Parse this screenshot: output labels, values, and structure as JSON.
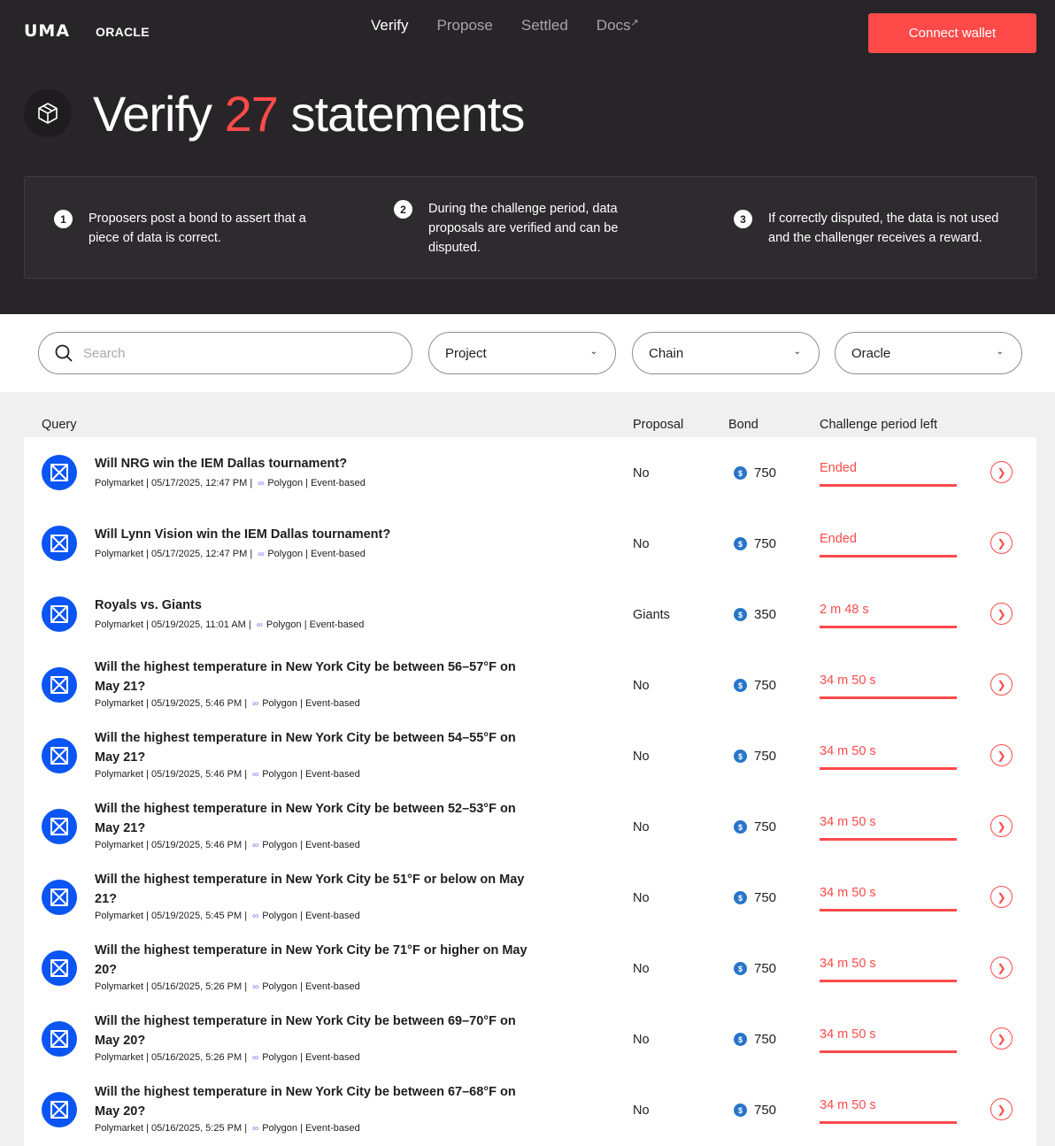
{
  "header": {
    "logo": "UMA",
    "logo_sub": "ORACLE",
    "nav": [
      {
        "label": "Verify"
      },
      {
        "label": "Propose"
      },
      {
        "label": "Settled"
      },
      {
        "label": "Docs"
      }
    ],
    "connect_label": "Connect wallet"
  },
  "hero": {
    "title_pre": "Verify",
    "title_count": "27",
    "title_post": "statements",
    "steps": [
      {
        "num": "1",
        "text": "Proposers post a bond to assert that a piece of data is correct."
      },
      {
        "num": "2",
        "text": "During the challenge period, data proposals are verified and can be disputed."
      },
      {
        "num": "3",
        "text": "If correctly disputed, the data is not used and the challenger receives a reward."
      }
    ]
  },
  "filters": {
    "search_placeholder": "Search",
    "project": "Project",
    "chain": "Chain",
    "oracle": "Oracle"
  },
  "table": {
    "columns": [
      "Query",
      "Proposal",
      "Bond",
      "Challenge period left"
    ],
    "rows": [
      {
        "title": "Will NRG win the IEM Dallas tournament?",
        "project": "Polymarket",
        "date": "05/17/2025, 12:47 PM",
        "chain": "Polygon",
        "type": "Event-based",
        "proposal": "No",
        "bond": "750",
        "period": "Ended"
      },
      {
        "title": "Will Lynn Vision win the IEM Dallas tournament?",
        "project": "Polymarket",
        "date": "05/17/2025, 12:47 PM",
        "chain": "Polygon",
        "type": "Event-based",
        "proposal": "No",
        "bond": "750",
        "period": "Ended"
      },
      {
        "title": "Royals vs. Giants",
        "project": "Polymarket",
        "date": "05/19/2025, 11:01 AM",
        "chain": "Polygon",
        "type": "Event-based",
        "proposal": "Giants",
        "bond": "350",
        "period": "2 m 48 s"
      },
      {
        "title": "Will the highest temperature in New York City be between 56–57°F on May 21?",
        "project": "Polymarket",
        "date": "05/19/2025, 5:46 PM",
        "chain": "Polygon",
        "type": "Event-based",
        "proposal": "No",
        "bond": "750",
        "period": "34 m 50 s"
      },
      {
        "title": "Will the highest temperature in New York City be between 54–55°F on May 21?",
        "project": "Polymarket",
        "date": "05/19/2025, 5:46 PM",
        "chain": "Polygon",
        "type": "Event-based",
        "proposal": "No",
        "bond": "750",
        "period": "34 m 50 s"
      },
      {
        "title": "Will the highest temperature in New York City be between 52–53°F on May 21?",
        "project": "Polymarket",
        "date": "05/19/2025, 5:46 PM",
        "chain": "Polygon",
        "type": "Event-based",
        "proposal": "No",
        "bond": "750",
        "period": "34 m 50 s"
      },
      {
        "title": "Will the highest temperature in New York City be 51°F or below on May 21?",
        "project": "Polymarket",
        "date": "05/19/2025, 5:45 PM",
        "chain": "Polygon",
        "type": "Event-based",
        "proposal": "No",
        "bond": "750",
        "period": "34 m 50 s"
      },
      {
        "title": "Will the highest temperature in New York City be 71°F or higher on May 20?",
        "project": "Polymarket",
        "date": "05/16/2025, 5:26 PM",
        "chain": "Polygon",
        "type": "Event-based",
        "proposal": "No",
        "bond": "750",
        "period": "34 m 50 s"
      },
      {
        "title": "Will the highest temperature in New York City be between 69–70°F on May 20?",
        "project": "Polymarket",
        "date": "05/16/2025, 5:26 PM",
        "chain": "Polygon",
        "type": "Event-based",
        "proposal": "No",
        "bond": "750",
        "period": "34 m 50 s"
      },
      {
        "title": "Will the highest temperature in New York City be between 67–68°F on May 20?",
        "project": "Polymarket",
        "date": "05/16/2025, 5:25 PM",
        "chain": "Polygon",
        "type": "Event-based",
        "proposal": "No",
        "bond": "750",
        "period": "34 m 50 s"
      }
    ]
  },
  "colors": {
    "accent": "#ff4a4a",
    "hero_bg": "#272528",
    "project_icon": "#0a55f3",
    "usdc": "#2775ca"
  }
}
